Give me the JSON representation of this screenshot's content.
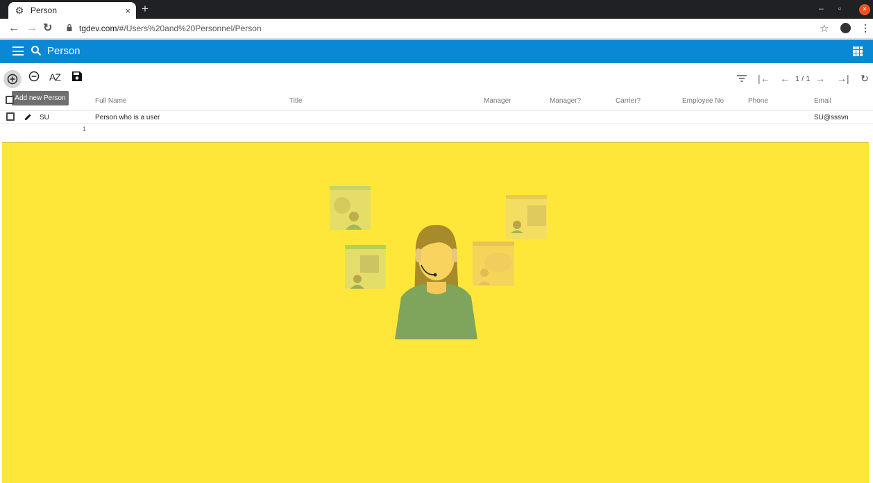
{
  "browser": {
    "tab_title": "Person",
    "tab_close": "×",
    "new_tab": "+",
    "url_host": "tgdev.com",
    "url_path": "/#/Users%20and%20Personnel/Person"
  },
  "app": {
    "title": "Person",
    "accent_color": "#0a88d6"
  },
  "toolbar": {
    "tooltip": "Add new Person",
    "sort_label": "AZ",
    "page_info": "1 / 1"
  },
  "grid": {
    "columns": [
      "Full Name",
      "Title",
      "Manager",
      "Manager?",
      "Carrier?",
      "Employee No",
      "Phone",
      "Email"
    ],
    "rows": [
      {
        "code": "SU",
        "full_name": "Person who is a user",
        "title": "",
        "manager": "",
        "is_manager": "",
        "carrier": "",
        "employee_no": "",
        "phone": "",
        "email": "SU@sssvn"
      }
    ],
    "count": "1"
  },
  "banner": {
    "background_color": "#ffe739"
  }
}
